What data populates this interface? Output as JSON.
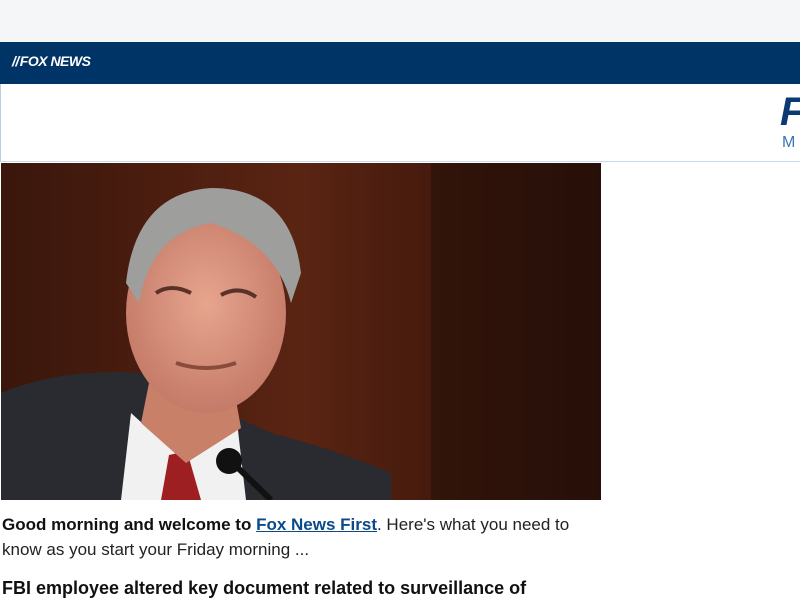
{
  "brand": {
    "logo_text": "FOX NEWS"
  },
  "header": {
    "title_fragment": "F",
    "subtitle_fragment": "M"
  },
  "hero_image": {
    "description_name": "hero-photo"
  },
  "intro": {
    "lead": "Good morning and welcome to ",
    "link_text": "Fox News First",
    "rest": ". Here's what you need to know as you start your Friday morning ..."
  },
  "headline": {
    "text": "FBI employee altered key document related to surveillance of"
  },
  "colors": {
    "brand_bar": "#003366",
    "link": "#0b4a8a",
    "header_title": "#0b3a73",
    "header_subtitle": "#3d74b4"
  }
}
